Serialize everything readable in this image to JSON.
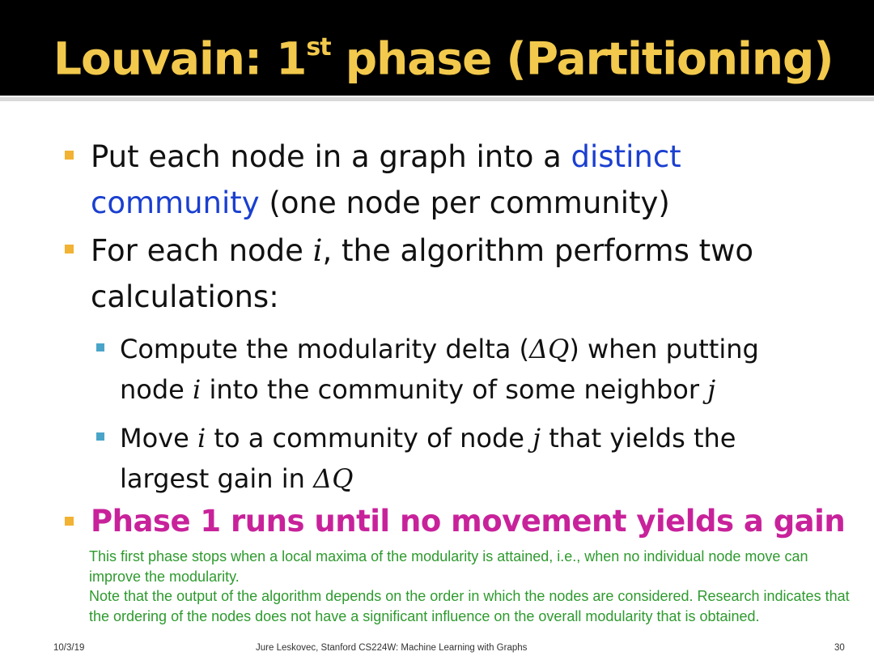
{
  "slide": {
    "title_main": "Louvain: 1",
    "title_sup": "st",
    "title_rest": " phase (Partitioning)",
    "bullet1": {
      "text_a": "Put each node in a graph into a ",
      "highlight_a": "distinct",
      "highlight_b": "community",
      "text_b": " (one node per community)"
    },
    "bullet2": {
      "text_a": "For each node ",
      "var_i": "i",
      "text_b": ", the algorithm performs two",
      "text_c": "calculations:"
    },
    "sub1": {
      "text_a": "Compute the modularity delta (",
      "delta_q": "ΔQ",
      "text_b": ") when putting",
      "text_c": "node ",
      "var_i": "i",
      "text_d": " into the community of some neighbor ",
      "var_j": "j"
    },
    "sub2": {
      "text_a": "Move ",
      "var_i": "i",
      "text_b": " to a community of node ",
      "var_j": "j",
      "text_c": " that yields the",
      "text_d": "largest gain in ",
      "delta_q": "ΔQ"
    },
    "bullet3": "Phase 1 runs until no movement yields a gain",
    "notes": [
      "This first phase stops when a local maxima of the modularity is attained, i.e., when no individual node move can improve the modularity.",
      "Note that the output of the algorithm depends on the order in which the nodes are considered. Research indicates that the ordering of the nodes does not have a significant influence on the overall modularity that is obtained."
    ]
  },
  "footer": {
    "date": "10/3/19",
    "center": "Jure Leskovec, Stanford CS224W: Machine Learning with Graphs",
    "page": "30"
  },
  "colors": {
    "title": "#f2c94c",
    "highlight_blue": "#1a3fd0",
    "magenta": "#c8229b",
    "note_green": "#2e9a2e",
    "bullet_marker": "#f2b233",
    "sub_marker": "#4aa4c8"
  }
}
